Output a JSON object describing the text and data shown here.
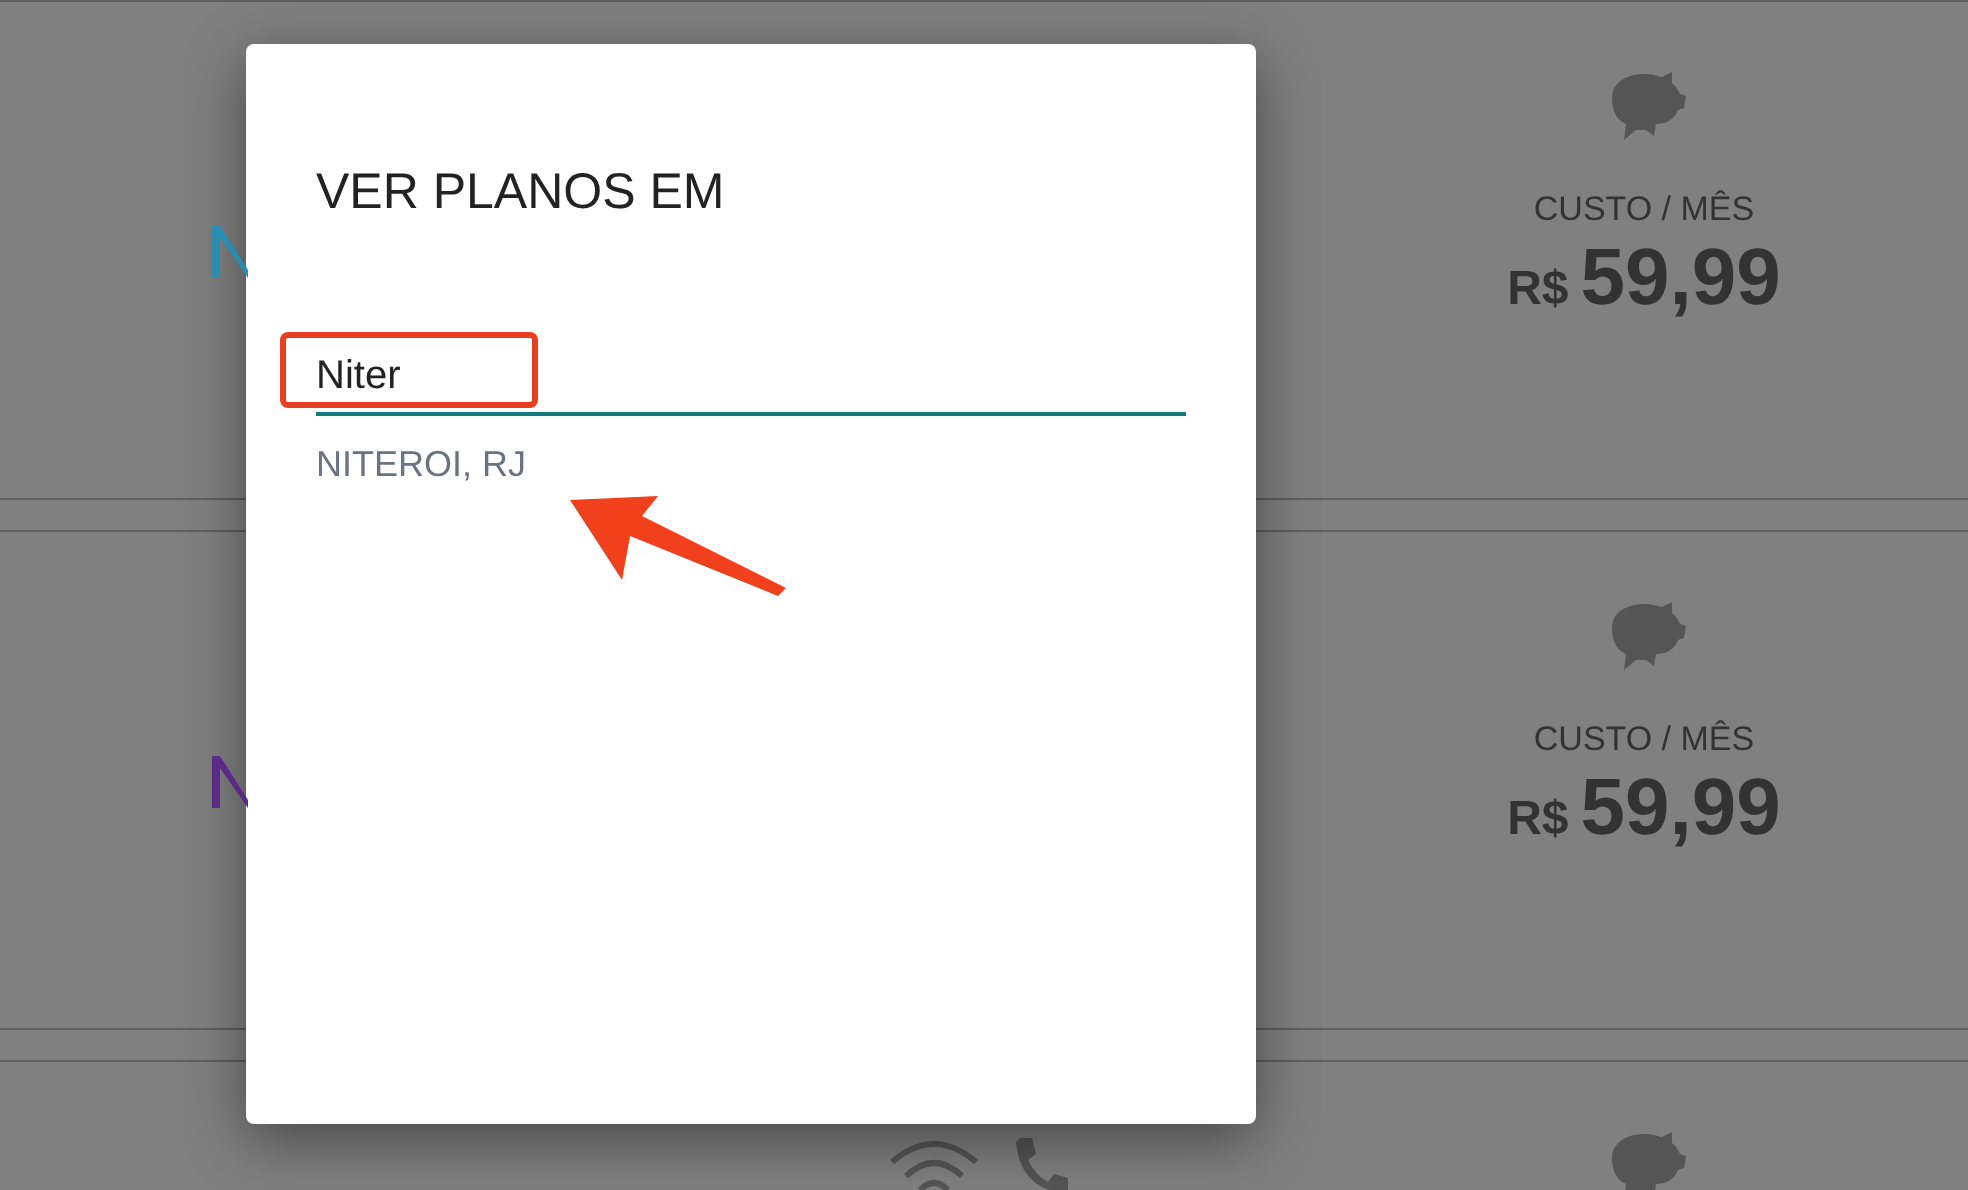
{
  "plans": [
    {
      "kind": "price",
      "color": "#2a8db0",
      "cost_label": "CUSTO / MÊS",
      "currency": "R$",
      "price": "59,99"
    },
    {
      "kind": "price",
      "color": "#5b2a86",
      "cost_label": "CUSTO / MÊS",
      "currency": "R$",
      "price": "59,99"
    },
    {
      "kind": "icons"
    }
  ],
  "dialog": {
    "title": "VER PLANOS EM",
    "field": {
      "value": "Niter"
    },
    "suggestions": [
      "NITEROI, RJ"
    ]
  }
}
